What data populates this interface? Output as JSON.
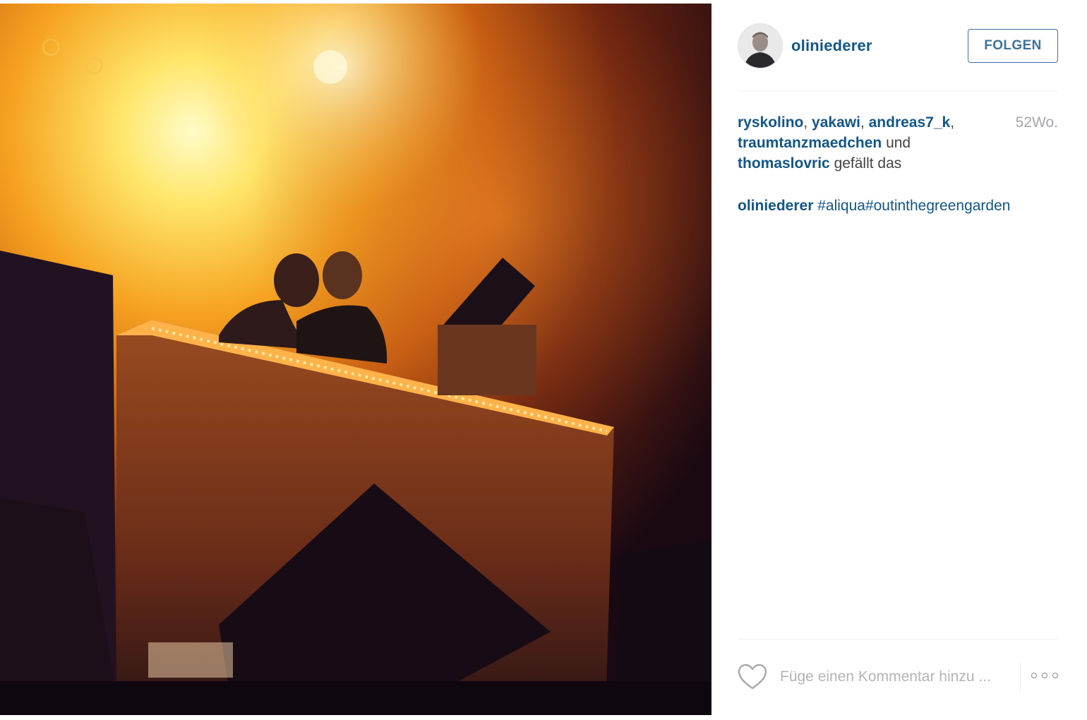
{
  "post": {
    "author": "oliniederer",
    "follow_label": "FOLGEN",
    "age": "52Wo.",
    "likers": [
      "ryskolino",
      "yakawi",
      "andreas7_k",
      "traumtanzmaedchen",
      "thomaslovric"
    ],
    "likes_connector": "und",
    "likes_suffix": "gefällt das",
    "caption_user": "oliniederer",
    "caption_tags": "#aliqua#outinthegreengarden",
    "comment_placeholder": "Füge einen Kommentar hinzu ...",
    "icons": {
      "like": "heart-outline-icon",
      "more": "more-options-icon"
    }
  },
  "colors": {
    "link": "#125688",
    "follow": "#3f729b",
    "muted": "#a5a7aa",
    "text": "#444444"
  }
}
